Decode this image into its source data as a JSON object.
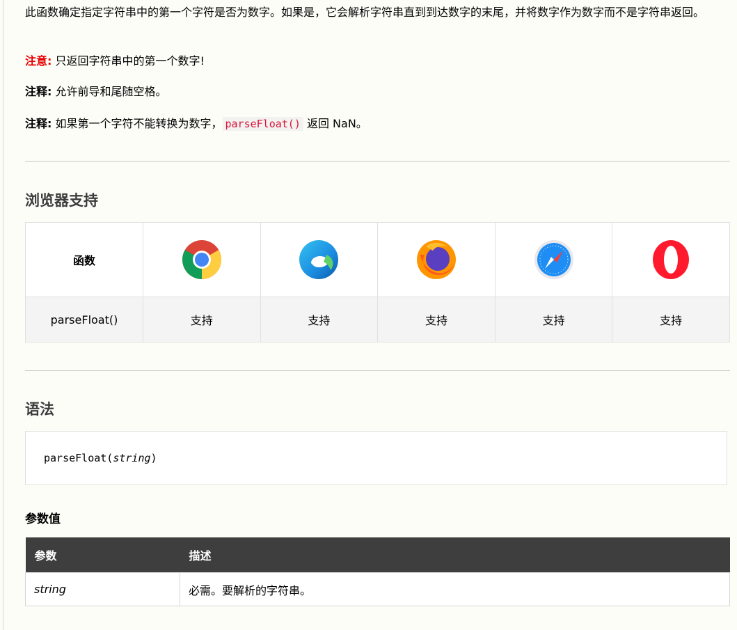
{
  "intro": {
    "paragraph": "此函数确定指定字符串中的第一个字符是否为数字。如果是，它会解析字符串直到到达数字的末尾，并将数字作为数字而不是字符串返回。",
    "note_label": "注意:",
    "note_text": " 只返回字符串中的第一个数字!",
    "remark1_label": "注释:",
    "remark1_text": " 允许前导和尾随空格。",
    "remark2_label": "注释:",
    "remark2_text_before": " 如果第一个字符不能转换为数字，",
    "remark2_code": "parseFloat()",
    "remark2_text_after": " 返回 NaN。"
  },
  "browser_support": {
    "heading": "浏览器支持",
    "function_header": "函数",
    "browsers": [
      {
        "name": "Chrome",
        "icon": "chrome-icon"
      },
      {
        "name": "Edge",
        "icon": "edge-icon"
      },
      {
        "name": "Firefox",
        "icon": "firefox-icon"
      },
      {
        "name": "Safari",
        "icon": "safari-icon"
      },
      {
        "name": "Opera",
        "icon": "opera-icon"
      }
    ],
    "row": {
      "function": "parseFloat()",
      "support": [
        "支持",
        "支持",
        "支持",
        "支持",
        "支持"
      ]
    }
  },
  "syntax": {
    "heading": "语法",
    "code_prefix": "parseFloat(",
    "code_param": "string",
    "code_suffix": ")"
  },
  "parameters": {
    "heading": "参数值",
    "columns": [
      "参数",
      "描述"
    ],
    "rows": [
      {
        "param": "string",
        "description": "必需。要解析的字符串。"
      }
    ]
  },
  "colors": {
    "note": "#e80000",
    "code": "#dc143c",
    "table_header_bg": "#3e3e3e",
    "page_bg": "#fdfdf8"
  }
}
